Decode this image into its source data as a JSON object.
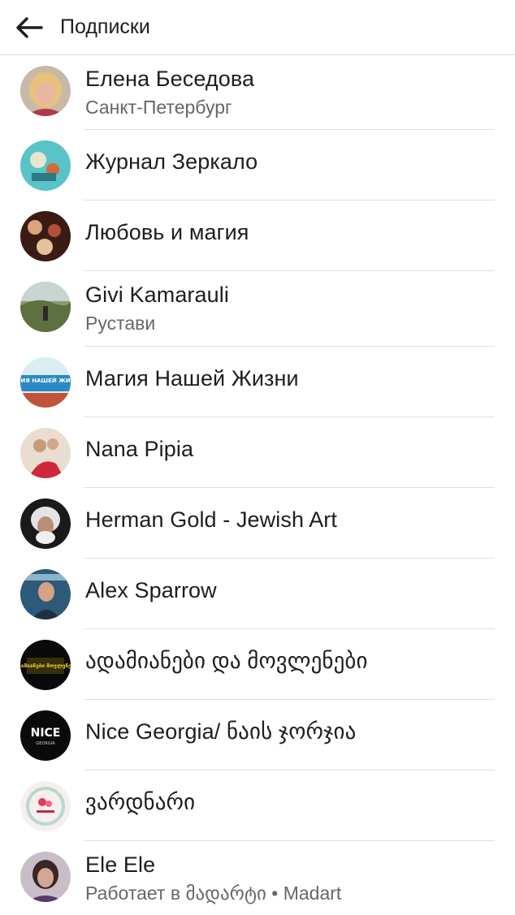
{
  "header": {
    "title": "Подписки"
  },
  "subscriptions": [
    {
      "name": "Елена Беседова",
      "sub": "Санкт-Петербург"
    },
    {
      "name": "Журнал Зеркало",
      "sub": ""
    },
    {
      "name": "Любовь и магия",
      "sub": ""
    },
    {
      "name": "Givi Kamarauli",
      "sub": "Рустави"
    },
    {
      "name": "Магия Нашей Жизни",
      "sub": "",
      "avatar_text": "МАГИЯ НАШЕЙ ЖИЗНИ"
    },
    {
      "name": "Nana Pipia",
      "sub": ""
    },
    {
      "name": "Herman Gold - Jewish Art",
      "sub": ""
    },
    {
      "name": "Alex Sparrow",
      "sub": ""
    },
    {
      "name": "ადამიანები და მოვლენები",
      "sub": "",
      "avatar_text": "ადამიანები მოვლენები"
    },
    {
      "name": "Nice Georgia/ ნაის ჯორჯია",
      "sub": "",
      "avatar_text": "NICE",
      "avatar_subtext": "GEORGIA"
    },
    {
      "name": "ვარდნარი",
      "sub": ""
    },
    {
      "name": "Ele Ele",
      "sub": "Работает в მადარტი • Madart"
    }
  ]
}
